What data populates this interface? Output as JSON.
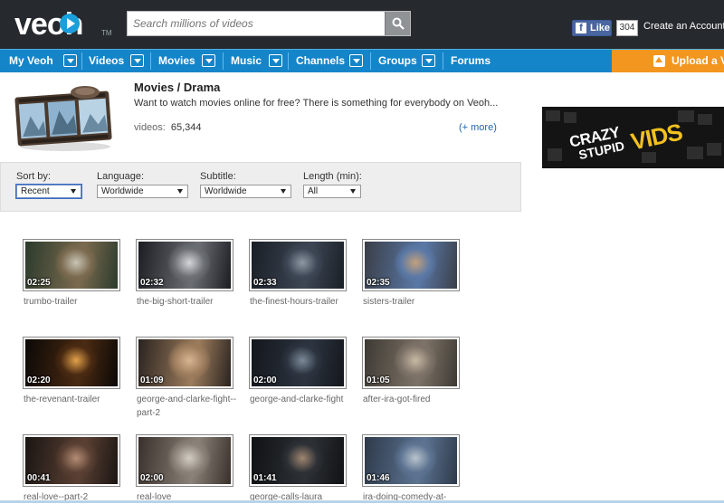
{
  "header": {
    "logo_text": "veoh",
    "logo_tm": "TM",
    "search_placeholder": "Search millions of videos",
    "fb_like": "Like",
    "fb_count": "304",
    "create_account": "Create an Account"
  },
  "nav": {
    "items": [
      {
        "label": "My Veoh",
        "dropdown": true
      },
      {
        "label": "Videos",
        "dropdown": true
      },
      {
        "label": "Movies",
        "dropdown": true
      },
      {
        "label": "Music",
        "dropdown": true
      },
      {
        "label": "Channels",
        "dropdown": true
      },
      {
        "label": "Groups",
        "dropdown": true
      },
      {
        "label": "Forums",
        "dropdown": false
      }
    ],
    "upload_label": "Upload a V"
  },
  "channel": {
    "title": "Movies / Drama",
    "description": "Want to watch movies online for free? There is something for everybody on Veoh...",
    "videos_label": "videos:",
    "videos_count": "65,344",
    "more_link": "(+ more)"
  },
  "ad": {
    "line1": "CRAZY",
    "line2": "STUPID",
    "line3": "VIDS"
  },
  "filters": {
    "sort": {
      "label": "Sort by:",
      "value": "Recent"
    },
    "language": {
      "label": "Language:",
      "value": "Worldwide"
    },
    "subtitle": {
      "label": "Subtitle:",
      "value": "Worldwide"
    },
    "length": {
      "label": "Length (min):",
      "value": "All"
    }
  },
  "videos": [
    {
      "title": "trumbo-trailer",
      "duration": "02:25",
      "colors": [
        "#2b3a2c",
        "#7a6a4f",
        "#c9c4b5"
      ]
    },
    {
      "title": "the-big-short-trailer",
      "duration": "02:32",
      "colors": [
        "#1b1d22",
        "#6b6e73",
        "#d4d6da"
      ]
    },
    {
      "title": "the-finest-hours-trailer",
      "duration": "02:33",
      "colors": [
        "#1a1f26",
        "#3c4654",
        "#8e98a5"
      ]
    },
    {
      "title": "sisters-trailer",
      "duration": "02:35",
      "colors": [
        "#3a3e47",
        "#5a78a6",
        "#c2a07c"
      ]
    },
    {
      "title": "the-revenant-trailer",
      "duration": "02:20",
      "colors": [
        "#0b0806",
        "#4a2a12",
        "#e3a24a"
      ]
    },
    {
      "title": "george-and-clarke-fight--part-2",
      "duration": "01:09",
      "colors": [
        "#2a2320",
        "#9c7c5c",
        "#d9b591"
      ]
    },
    {
      "title": "george-and-clarke-fight",
      "duration": "02:00",
      "colors": [
        "#14171c",
        "#2c3440",
        "#7c8a99"
      ]
    },
    {
      "title": "after-ira-got-fired",
      "duration": "01:05",
      "colors": [
        "#3d3a33",
        "#7e7368",
        "#c8b9a4"
      ]
    },
    {
      "title": "real-love--part-2",
      "duration": "00:41",
      "colors": [
        "#1a1513",
        "#5a4033",
        "#b58c74"
      ]
    },
    {
      "title": "real-love",
      "duration": "02:00",
      "colors": [
        "#39302b",
        "#8a8278",
        "#d2cdc4"
      ]
    },
    {
      "title": "george-calls-laura",
      "duration": "01:41",
      "colors": [
        "#101214",
        "#2d3136",
        "#a08670"
      ]
    },
    {
      "title": "ira-doing-comedy-at-",
      "duration": "01:46",
      "colors": [
        "#2e3a4a",
        "#5c7391",
        "#b9c3cd"
      ]
    }
  ]
}
